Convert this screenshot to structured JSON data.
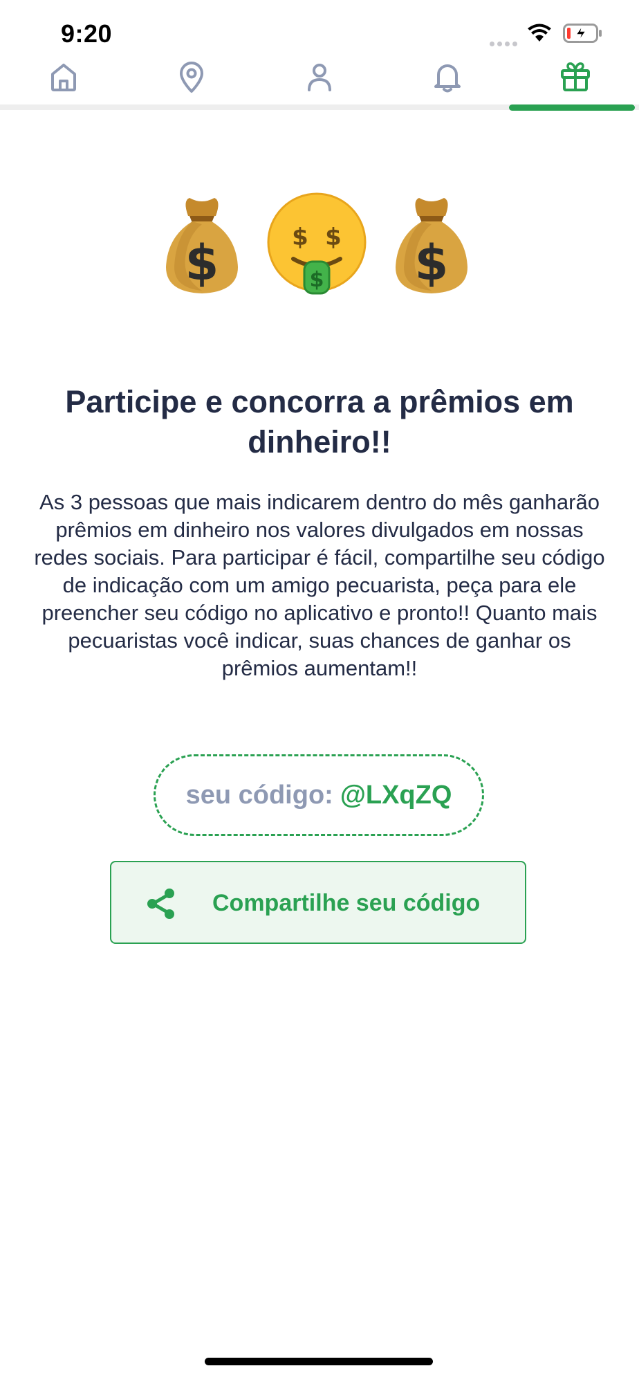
{
  "status_bar": {
    "time": "9:20"
  },
  "tabs": [
    {
      "name": "home",
      "icon": "home-icon",
      "active": false
    },
    {
      "name": "location",
      "icon": "map-pin-icon",
      "active": false
    },
    {
      "name": "profile",
      "icon": "user-icon",
      "active": false
    },
    {
      "name": "notifications",
      "icon": "bell-icon",
      "active": false
    },
    {
      "name": "rewards",
      "icon": "gift-icon",
      "active": true
    }
  ],
  "colors": {
    "accent": "#2aa152",
    "inactive_icon": "#8e99b3",
    "text": "#232b45",
    "button_bg": "#edf7ef"
  },
  "hero": {
    "emojis": [
      "money-bag-icon",
      "money-mouth-face-icon",
      "money-bag-icon"
    ]
  },
  "content": {
    "title": "Participe e concorra a prêmios em dinheiro!!",
    "description": "As 3 pessoas que mais indicarem dentro do mês ganharão prêmios em dinheiro nos valores divulgados em nossas redes sociais. Para participar é fácil, compartilhe seu código de indicação com um amigo pecuarista, peça para ele preencher seu código no aplicativo e pronto!! Quanto mais pecuaristas você indicar, suas chances de ganhar os prêmios aumentam!!",
    "code_label": "seu código:",
    "code_value": "@LXqZQ",
    "share_button_label": "Compartilhe seu código"
  }
}
